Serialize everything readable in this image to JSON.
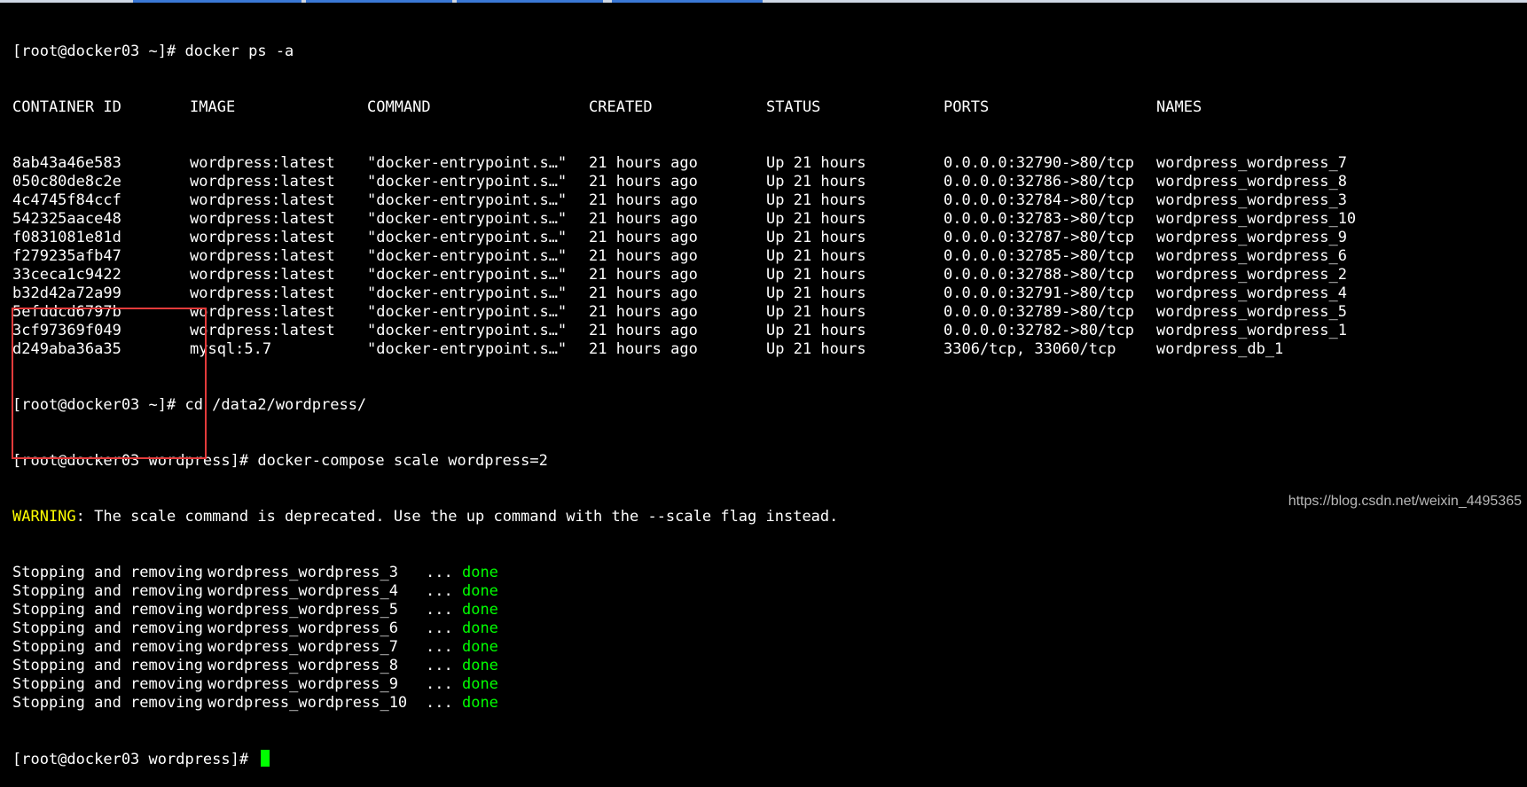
{
  "terminal": {
    "prompt_home": "[root@docker03 ~]# ",
    "prompt_wordpress": "[root@docker03 wordpress]# ",
    "cmd_ps": "docker ps -a",
    "cmd_cd": "cd /data2/wordpress/",
    "cmd_scale": "docker-compose scale wordpress=2",
    "headers": {
      "container_id": "CONTAINER ID",
      "image": "IMAGE",
      "command": "COMMAND",
      "created": "CREATED",
      "status": "STATUS",
      "ports": "PORTS",
      "names": "NAMES"
    },
    "rows": [
      {
        "id": "8ab43a46e583",
        "image": "wordpress:latest",
        "command": "\"docker-entrypoint.s…\"",
        "created": "21 hours ago",
        "status": "Up 21 hours",
        "ports": "0.0.0.0:32790->80/tcp",
        "names": "wordpress_wordpress_7"
      },
      {
        "id": "050c80de8c2e",
        "image": "wordpress:latest",
        "command": "\"docker-entrypoint.s…\"",
        "created": "21 hours ago",
        "status": "Up 21 hours",
        "ports": "0.0.0.0:32786->80/tcp",
        "names": "wordpress_wordpress_8"
      },
      {
        "id": "4c4745f84ccf",
        "image": "wordpress:latest",
        "command": "\"docker-entrypoint.s…\"",
        "created": "21 hours ago",
        "status": "Up 21 hours",
        "ports": "0.0.0.0:32784->80/tcp",
        "names": "wordpress_wordpress_3"
      },
      {
        "id": "542325aace48",
        "image": "wordpress:latest",
        "command": "\"docker-entrypoint.s…\"",
        "created": "21 hours ago",
        "status": "Up 21 hours",
        "ports": "0.0.0.0:32783->80/tcp",
        "names": "wordpress_wordpress_10"
      },
      {
        "id": "f0831081e81d",
        "image": "wordpress:latest",
        "command": "\"docker-entrypoint.s…\"",
        "created": "21 hours ago",
        "status": "Up 21 hours",
        "ports": "0.0.0.0:32787->80/tcp",
        "names": "wordpress_wordpress_9"
      },
      {
        "id": "f279235afb47",
        "image": "wordpress:latest",
        "command": "\"docker-entrypoint.s…\"",
        "created": "21 hours ago",
        "status": "Up 21 hours",
        "ports": "0.0.0.0:32785->80/tcp",
        "names": "wordpress_wordpress_6"
      },
      {
        "id": "33ceca1c9422",
        "image": "wordpress:latest",
        "command": "\"docker-entrypoint.s…\"",
        "created": "21 hours ago",
        "status": "Up 21 hours",
        "ports": "0.0.0.0:32788->80/tcp",
        "names": "wordpress_wordpress_2"
      },
      {
        "id": "b32d42a72a99",
        "image": "wordpress:latest",
        "command": "\"docker-entrypoint.s…\"",
        "created": "21 hours ago",
        "status": "Up 21 hours",
        "ports": "0.0.0.0:32791->80/tcp",
        "names": "wordpress_wordpress_4"
      },
      {
        "id": "5efddcd6797b",
        "image": "wordpress:latest",
        "command": "\"docker-entrypoint.s…\"",
        "created": "21 hours ago",
        "status": "Up 21 hours",
        "ports": "0.0.0.0:32789->80/tcp",
        "names": "wordpress_wordpress_5"
      },
      {
        "id": "3cf97369f049",
        "image": "wordpress:latest",
        "command": "\"docker-entrypoint.s…\"",
        "created": "21 hours ago",
        "status": "Up 21 hours",
        "ports": "0.0.0.0:32782->80/tcp",
        "names": "wordpress_wordpress_1"
      },
      {
        "id": "d249aba36a35",
        "image": "mysql:5.7",
        "command": "\"docker-entrypoint.s…\"",
        "created": "21 hours ago",
        "status": "Up 21 hours",
        "ports": "3306/tcp, 33060/tcp",
        "names": "wordpress_db_1"
      }
    ],
    "warning_label": "WARNING",
    "warning_text": ": The scale command is deprecated. Use the up command with the --scale flag instead.",
    "removal_verb": "Stopping and removing",
    "removal_dots": "...",
    "removal_done": "done",
    "removals": [
      "wordpress_wordpress_3",
      "wordpress_wordpress_4",
      "wordpress_wordpress_5",
      "wordpress_wordpress_6",
      "wordpress_wordpress_7",
      "wordpress_wordpress_8",
      "wordpress_wordpress_9",
      "wordpress_wordpress_10"
    ]
  },
  "watermark": "https://blog.csdn.net/weixin_4495365",
  "colors": {
    "background": "#000000",
    "text": "#ffffff",
    "warning": "#ffff00",
    "done": "#00ff00",
    "cursor": "#00ff00",
    "highlight_box": "#e33b3b"
  }
}
